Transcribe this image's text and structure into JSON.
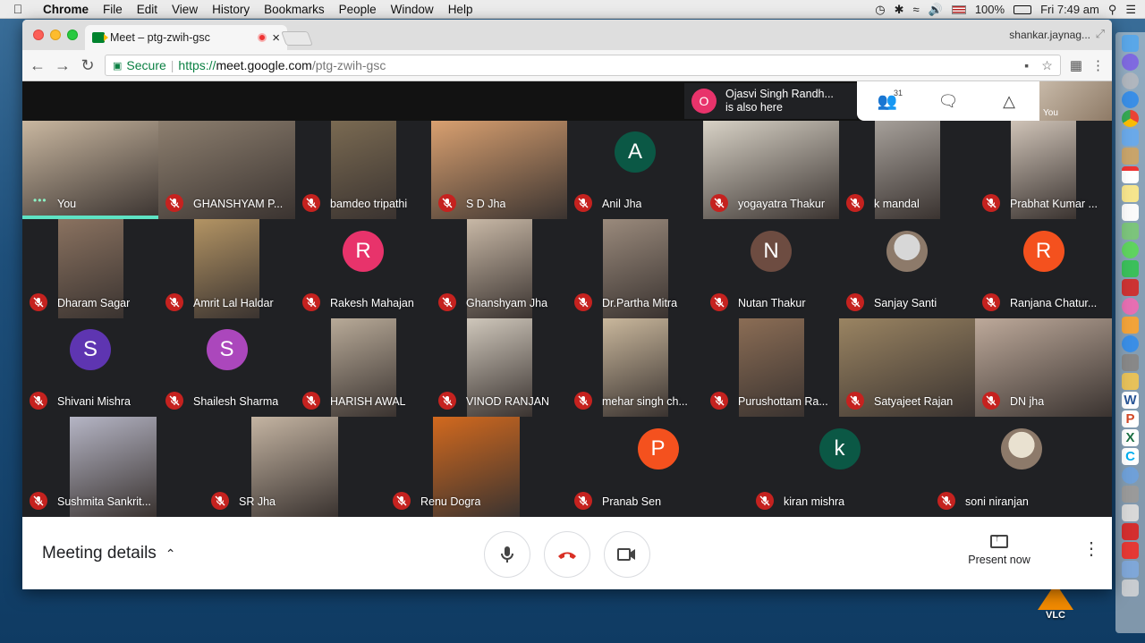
{
  "menubar": {
    "apple": "",
    "items": [
      "Chrome",
      "File",
      "Edit",
      "View",
      "History",
      "Bookmarks",
      "People",
      "Window",
      "Help"
    ],
    "battery": "100%",
    "clock": "Fri 7:49 am"
  },
  "browser": {
    "tab_title": "Meet – ptg-zwih-gsc",
    "tab_close": "×",
    "profile": "shankar.jaynag...",
    "secure_label": "Secure",
    "url_scheme": "https://",
    "url_host": "meet.google.com",
    "url_path": "/ptg-zwih-gsc"
  },
  "meet": {
    "toast_initial": "O",
    "toast_line1": "Ojasvi Singh Randh...",
    "toast_line2": "is also here",
    "participants_count": "31",
    "self_label": "You",
    "participants": [
      {
        "name": "You",
        "avatar": "",
        "color": "",
        "video": "#c9b7a0"
      },
      {
        "name": "GHANSHYAM P...",
        "avatar": "",
        "color": "",
        "video": "#8d7f6f"
      },
      {
        "name": "bamdeo tripathi",
        "avatar": "",
        "color": "",
        "video": "#7a6a52"
      },
      {
        "name": "S D Jha",
        "avatar": "",
        "color": "",
        "video": "#d9a070"
      },
      {
        "name": "Anil Jha",
        "avatar": "A",
        "color": "#0b5845",
        "video": ""
      },
      {
        "name": "yogayatra Thakur",
        "avatar": "",
        "color": "",
        "video": "#d8d2c6"
      },
      {
        "name": "k mandal",
        "avatar": "",
        "color": "",
        "video": "#a6a09a"
      },
      {
        "name": "Prabhat Kumar ...",
        "avatar": "",
        "color": "",
        "video": "#cfc3b7"
      },
      {
        "name": "Dharam Sagar",
        "avatar": "",
        "color": "",
        "video": "#8a7260"
      },
      {
        "name": "Amrit Lal Haldar",
        "avatar": "",
        "color": "",
        "video": "#b39464"
      },
      {
        "name": "Rakesh Mahajan",
        "avatar": "R",
        "color": "#e8336b",
        "video": ""
      },
      {
        "name": "Ghanshyam Jha",
        "avatar": "",
        "color": "",
        "video": "#c8b8a6"
      },
      {
        "name": "Dr.Partha Mitra",
        "avatar": "",
        "color": "",
        "video": "#9a8a7c"
      },
      {
        "name": "Nutan Thakur",
        "avatar": "N",
        "color": "#6d4c41",
        "video": ""
      },
      {
        "name": "Sanjay Santi",
        "avatar": "",
        "color": "#d7d7d7",
        "video": ""
      },
      {
        "name": "Ranjana Chatur...",
        "avatar": "R",
        "color": "#f4511e",
        "video": ""
      },
      {
        "name": "Shivani Mishra",
        "avatar": "S",
        "color": "#5e35b1",
        "video": ""
      },
      {
        "name": "Shailesh Sharma",
        "avatar": "S",
        "color": "#ab47bc",
        "video": ""
      },
      {
        "name": "HARISH AWAL",
        "avatar": "",
        "color": "",
        "video": "#b8aa98"
      },
      {
        "name": "VINOD RANJAN",
        "avatar": "",
        "color": "",
        "video": "#cfc7bb"
      },
      {
        "name": "mehar singh ch...",
        "avatar": "",
        "color": "",
        "video": "#c9b79c"
      },
      {
        "name": "Purushottam Ra...",
        "avatar": "",
        "color": "",
        "video": "#8b6d55"
      },
      {
        "name": "Satyajeet Rajan",
        "avatar": "",
        "color": "",
        "video": "#9a8462"
      },
      {
        "name": "DN jha",
        "avatar": "",
        "color": "",
        "video": "#bda99a"
      },
      {
        "name": "Sushmita Sankrit...",
        "avatar": "",
        "color": "",
        "video": "#b5b5c5"
      },
      {
        "name": "SR Jha",
        "avatar": "",
        "color": "",
        "video": "#c4b4a2"
      },
      {
        "name": "Renu Dogra",
        "avatar": "",
        "color": "",
        "video": "#d2691e"
      },
      {
        "name": "Pranab Sen",
        "avatar": "P",
        "color": "#f4511e",
        "video": ""
      },
      {
        "name": "kiran mishra",
        "avatar": "k",
        "color": "#0b5845",
        "video": ""
      },
      {
        "name": "soni niranjan",
        "avatar": "",
        "color": "#e9e1d0",
        "video": ""
      }
    ]
  },
  "bottom": {
    "meeting_details": "Meeting details",
    "present_now": "Present now"
  },
  "dock": {
    "vlc_label": "VLC"
  }
}
